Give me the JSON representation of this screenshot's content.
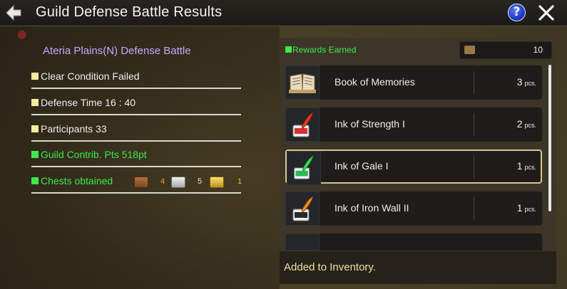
{
  "header": {
    "title": "Guild Defense Battle Results",
    "help_label": "?"
  },
  "summary": {
    "battle_name": "Ateria Plains(N) Defense Battle",
    "clear_condition": "Clear Condition Failed",
    "defense_time": "Defense Time 16 : 40",
    "participants": "Participants 33",
    "guild_contrib": "Guild Contrib. Pts 518pt",
    "chests_label": "Chests obtained",
    "chests": [
      {
        "icon": "wooden-chest-icon",
        "count": "4",
        "color": "#f0a030"
      },
      {
        "icon": "silver-chest-icon",
        "count": "5",
        "color": "#e8e8e8"
      },
      {
        "icon": "gold-chest-icon",
        "count": "1",
        "color": "#f0c030"
      }
    ]
  },
  "rewards": {
    "label": "Rewards Earned",
    "total_count": "10",
    "items": [
      {
        "name": "Book of Memories",
        "qty": "3",
        "unit": "pcs.",
        "icon": "book-icon",
        "selected": false
      },
      {
        "name": "Ink of Strength I",
        "qty": "2",
        "unit": "pcs.",
        "icon": "red-ink-icon",
        "selected": false
      },
      {
        "name": "Ink of Gale I",
        "qty": "1",
        "unit": "pcs.",
        "icon": "green-ink-icon",
        "selected": true
      },
      {
        "name": "Ink of Iron Wall II",
        "qty": "1",
        "unit": "pcs.",
        "icon": "orange-ink-icon",
        "selected": false
      }
    ]
  },
  "footer": {
    "message": "Added to Inventory."
  },
  "colors": {
    "accent_green": "#3ce84a",
    "battle_name_purple": "#c9a6ff",
    "selected_border": "#d9c48a"
  }
}
